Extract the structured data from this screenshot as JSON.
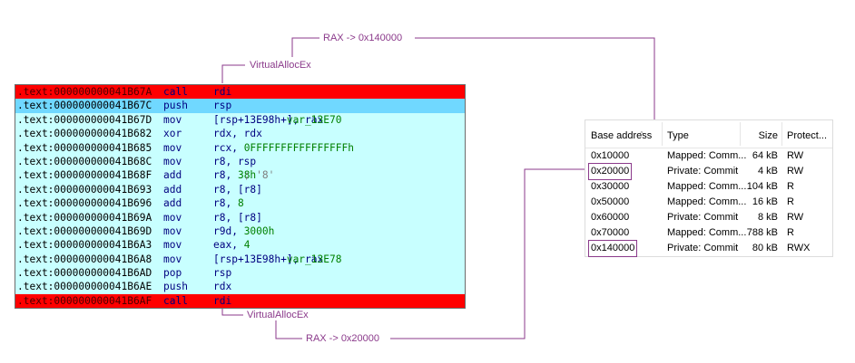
{
  "disassembly": {
    "rows": [
      {
        "addr": ".text:000000000041B67A",
        "mnemonic": "call",
        "operands": "rdi",
        "highlight": "red"
      },
      {
        "addr": ".text:000000000041B67C",
        "mnemonic": "push",
        "operands": "rsp",
        "highlight": "current"
      },
      {
        "addr": ".text:000000000041B67D",
        "mnemonic": "mov",
        "operands": "[rsp+13E98h+var_13E70], rax",
        "highlight": "none"
      },
      {
        "addr": ".text:000000000041B682",
        "mnemonic": "xor",
        "operands": "rdx, rdx",
        "highlight": "none"
      },
      {
        "addr": ".text:000000000041B685",
        "mnemonic": "mov",
        "operands": "rcx, 0FFFFFFFFFFFFFFFFh",
        "highlight": "none"
      },
      {
        "addr": ".text:000000000041B68C",
        "mnemonic": "mov",
        "operands": "r8, rsp",
        "highlight": "none"
      },
      {
        "addr": ".text:000000000041B68F",
        "mnemonic": "add",
        "operands": "r8, 38h ; '8'",
        "highlight": "none"
      },
      {
        "addr": ".text:000000000041B693",
        "mnemonic": "add",
        "operands": "r8, [r8]",
        "highlight": "none"
      },
      {
        "addr": ".text:000000000041B696",
        "mnemonic": "add",
        "operands": "r8, 8",
        "highlight": "none"
      },
      {
        "addr": ".text:000000000041B69A",
        "mnemonic": "mov",
        "operands": "r8, [r8]",
        "highlight": "none"
      },
      {
        "addr": ".text:000000000041B69D",
        "mnemonic": "mov",
        "operands": "r9d, 3000h",
        "highlight": "none"
      },
      {
        "addr": ".text:000000000041B6A3",
        "mnemonic": "mov",
        "operands": "eax, 4",
        "highlight": "none"
      },
      {
        "addr": ".text:000000000041B6A8",
        "mnemonic": "mov",
        "operands": "[rsp+13E98h+var_13E78], rax",
        "highlight": "none"
      },
      {
        "addr": ".text:000000000041B6AD",
        "mnemonic": "pop",
        "operands": "rsp",
        "highlight": "none"
      },
      {
        "addr": ".text:000000000041B6AE",
        "mnemonic": "push",
        "operands": "rdx",
        "highlight": "none"
      },
      {
        "addr": ".text:000000000041B6AF",
        "mnemonic": "call",
        "operands": "rdi",
        "highlight": "red"
      }
    ]
  },
  "annotations": {
    "top_call_label": "VirtualAllocEx",
    "top_result_label": "RAX -> 0x140000",
    "bottom_call_label": "VirtualAllocEx",
    "bottom_result_label": "RAX -> 0x20000",
    "line_color": "#8b3a8b"
  },
  "memory_table": {
    "headers": {
      "base": "Base address",
      "type": "Type",
      "size": "Size",
      "protect": "Protect..."
    },
    "sort_indicator": "^",
    "rows": [
      {
        "base": "0x10000",
        "type": "Mapped: Comm...",
        "size": "64 kB",
        "protect": "RW",
        "boxed": false
      },
      {
        "base": "0x20000",
        "type": "Private: Commit",
        "size": "4 kB",
        "protect": "RW",
        "boxed": true
      },
      {
        "base": "0x30000",
        "type": "Mapped: Comm...",
        "size": "104 kB",
        "protect": "R",
        "boxed": false
      },
      {
        "base": "0x50000",
        "type": "Mapped: Comm...",
        "size": "16 kB",
        "protect": "R",
        "boxed": false
      },
      {
        "base": "0x60000",
        "type": "Private: Commit",
        "size": "8 kB",
        "protect": "RW",
        "boxed": false
      },
      {
        "base": "0x70000",
        "type": "Mapped: Comm...",
        "size": "788 kB",
        "protect": "R",
        "boxed": false
      },
      {
        "base": "0x140000",
        "type": "Private: Commit",
        "size": "80 kB",
        "protect": "RWX",
        "boxed": true
      }
    ]
  },
  "colors": {
    "call_row": "#ff0000",
    "current_row": "#70d8ff",
    "listing_bg": "#c8ffff",
    "annotation": "#8b3a8b"
  }
}
